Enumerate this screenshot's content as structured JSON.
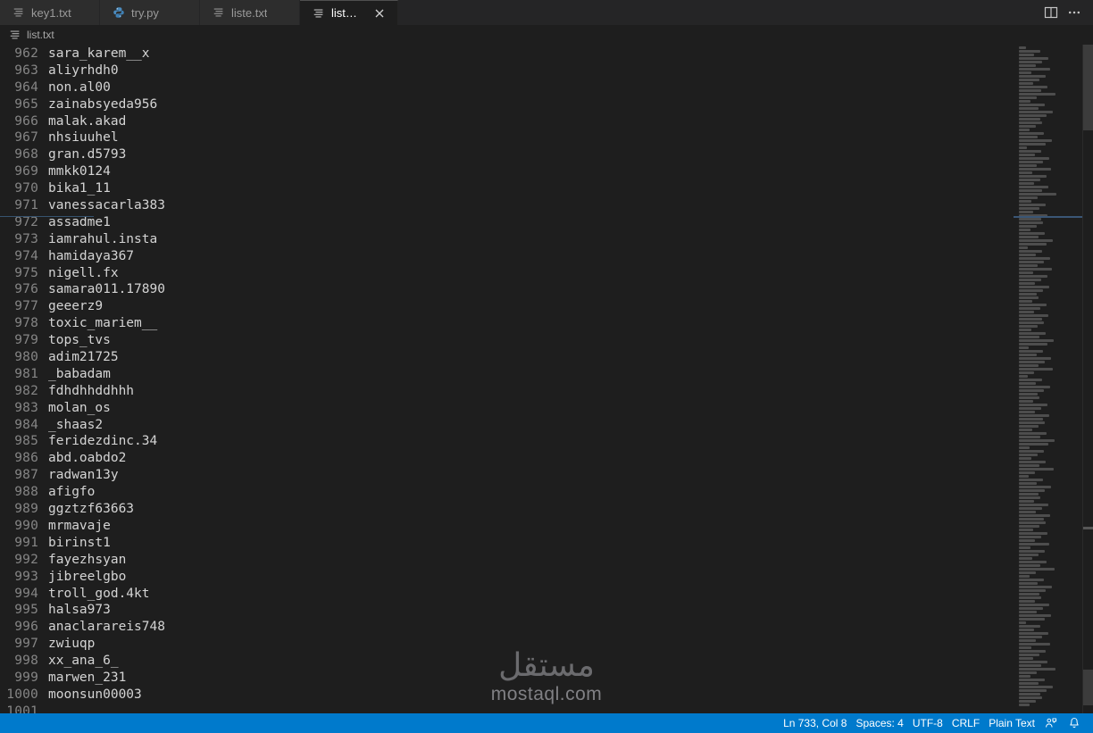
{
  "tabs": [
    {
      "label": "key1.txt",
      "icon": "text-file-icon",
      "active": false,
      "closable": false
    },
    {
      "label": "try.py",
      "icon": "python-file-icon",
      "active": false,
      "closable": false
    },
    {
      "label": "liste.txt",
      "icon": "text-file-icon",
      "active": false,
      "closable": false
    },
    {
      "label": "list.txt",
      "icon": "text-file-icon",
      "active": true,
      "closable": true
    }
  ],
  "tabbar_actions": [
    {
      "name": "split-editor-right-icon",
      "glyph": "split"
    },
    {
      "name": "more-actions-icon",
      "glyph": "ellipsis"
    }
  ],
  "breadcrumb": {
    "icon": "text-file-icon",
    "label": "list.txt"
  },
  "editor": {
    "first_line_number": 962,
    "lines": [
      {
        "number": 962,
        "text": "sara_karem__x"
      },
      {
        "number": 963,
        "text": "aliyrhdh0"
      },
      {
        "number": 964,
        "text": "non.al00"
      },
      {
        "number": 965,
        "text": "zainabsyeda956"
      },
      {
        "number": 966,
        "text": "malak.akad"
      },
      {
        "number": 967,
        "text": "nhsiuuhel"
      },
      {
        "number": 968,
        "text": "gran.d5793"
      },
      {
        "number": 969,
        "text": "mmkk0124"
      },
      {
        "number": 970,
        "text": "bika1_11"
      },
      {
        "number": 971,
        "text": "vanessacarla383"
      },
      {
        "number": 972,
        "text": "assadme1"
      },
      {
        "number": 973,
        "text": "iamrahul.insta"
      },
      {
        "number": 974,
        "text": "hamidaya367"
      },
      {
        "number": 975,
        "text": "nigell.fx"
      },
      {
        "number": 976,
        "text": "samara011.17890"
      },
      {
        "number": 977,
        "text": "geeerz9"
      },
      {
        "number": 978,
        "text": "toxic_mariem__"
      },
      {
        "number": 979,
        "text": "tops_tvs"
      },
      {
        "number": 980,
        "text": "adim21725"
      },
      {
        "number": 981,
        "text": "_babadam"
      },
      {
        "number": 982,
        "text": "fdhdhhddhhh"
      },
      {
        "number": 983,
        "text": "molan_os"
      },
      {
        "number": 984,
        "text": "_shaas2"
      },
      {
        "number": 985,
        "text": "feridezdinc.34"
      },
      {
        "number": 986,
        "text": "abd.oabdo2"
      },
      {
        "number": 987,
        "text": "radwan13y"
      },
      {
        "number": 988,
        "text": "afigfo"
      },
      {
        "number": 989,
        "text": "ggztzf63663"
      },
      {
        "number": 990,
        "text": "mrmavaje"
      },
      {
        "number": 991,
        "text": "birinst1"
      },
      {
        "number": 992,
        "text": "fayezhsyan"
      },
      {
        "number": 993,
        "text": "jibreelgbo"
      },
      {
        "number": 994,
        "text": "troll_god.4kt"
      },
      {
        "number": 995,
        "text": "halsa973"
      },
      {
        "number": 996,
        "text": "anaclarareis748"
      },
      {
        "number": 997,
        "text": "zwiuqp"
      },
      {
        "number": 998,
        "text": "xx_ana_6_"
      },
      {
        "number": 999,
        "text": "marwen_231"
      },
      {
        "number": 1000,
        "text": "moonsun00003"
      },
      {
        "number": 1001,
        "text": ""
      }
    ]
  },
  "watermark": {
    "arabic": "مستقل",
    "latin": "mostaql.com"
  },
  "statusbar": {
    "cursor": "Ln 733, Col 8",
    "indentation": "Spaces: 4",
    "encoding": "UTF-8",
    "eol": "CRLF",
    "language": "Plain Text",
    "feedback_icon": "feedback-smiley-icon",
    "notifications_icon": "bell-icon"
  },
  "colors": {
    "accent": "#007acc",
    "editor_background": "#1e1e1e",
    "tabbar_background": "#252526",
    "inactive_tab_background": "#2d2d2d",
    "text": "#d4d4d4",
    "line_number": "#858585"
  }
}
